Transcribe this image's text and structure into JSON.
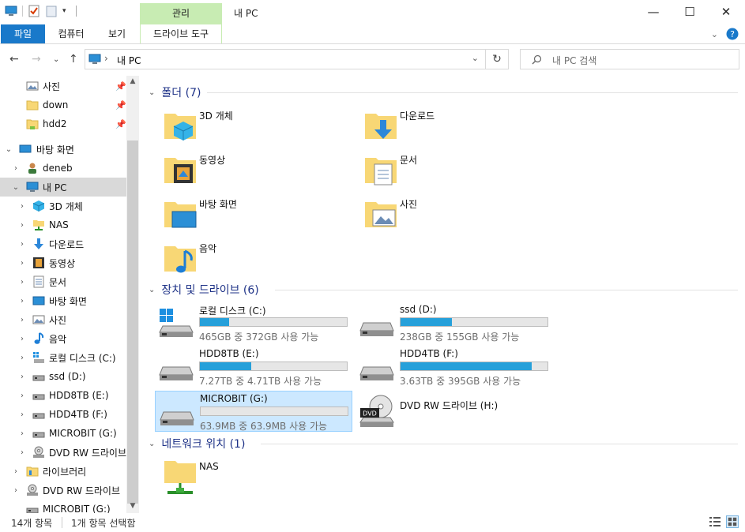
{
  "titlebar": {
    "context_tab_group": "관리",
    "window_title": "내 PC",
    "minimize": "—",
    "maximize": "☐",
    "close": "✕"
  },
  "ribbon": {
    "tabs": [
      "파일",
      "컴퓨터",
      "보기",
      "드라이브 도구"
    ]
  },
  "address": {
    "path_sep": "›",
    "path": "내 PC",
    "refresh": "↻",
    "search_placeholder": "내 PC 검색"
  },
  "nav": {
    "quick_access": [
      {
        "label": "사진",
        "icon": "pictures-icon",
        "pinned": true
      },
      {
        "label": "down",
        "icon": "folder-icon",
        "pinned": true
      },
      {
        "label": "hdd2",
        "icon": "folder-icon",
        "pinned": true
      }
    ],
    "desktop": "바탕 화면",
    "user": "deneb",
    "this_pc": "내 PC",
    "pc_children": [
      {
        "label": "3D 개체",
        "icon": "3d-objects-icon"
      },
      {
        "label": "NAS",
        "icon": "network-drive-icon"
      },
      {
        "label": "다운로드",
        "icon": "download-icon"
      },
      {
        "label": "동영상",
        "icon": "video-icon"
      },
      {
        "label": "문서",
        "icon": "document-icon"
      },
      {
        "label": "바탕 화면",
        "icon": "desktop-icon"
      },
      {
        "label": "사진",
        "icon": "pictures-icon"
      },
      {
        "label": "음악",
        "icon": "music-icon"
      },
      {
        "label": "로컬 디스크 (C:)",
        "icon": "windows-drive-icon"
      },
      {
        "label": "ssd (D:)",
        "icon": "drive-icon"
      },
      {
        "label": "HDD8TB (E:)",
        "icon": "drive-icon"
      },
      {
        "label": "HDD4TB (F:)",
        "icon": "drive-icon"
      },
      {
        "label": "MICROBIT (G:)",
        "icon": "drive-icon"
      },
      {
        "label": "DVD RW 드라이브",
        "icon": "dvd-icon"
      }
    ],
    "libraries": "라이브러리",
    "dvd_root": "DVD RW 드라이브",
    "microbit_root": "MICROBIT (G:)"
  },
  "content": {
    "folders_header": "폴더 (7)",
    "folders": [
      {
        "label": "3D 개체",
        "icon": "3d-objects-icon"
      },
      {
        "label": "다운로드",
        "icon": "download-icon"
      },
      {
        "label": "동영상",
        "icon": "video-icon"
      },
      {
        "label": "문서",
        "icon": "document-icon"
      },
      {
        "label": "바탕 화면",
        "icon": "desktop-icon"
      },
      {
        "label": "사진",
        "icon": "pictures-icon"
      },
      {
        "label": "음악",
        "icon": "music-icon"
      }
    ],
    "devices_header": "장치 및 드라이브 (6)",
    "drives": [
      {
        "label": "로컬 디스크 (C:)",
        "free": "465GB 중 372GB 사용 가능",
        "used_fraction": 0.2
      },
      {
        "label": "ssd (D:)",
        "free": "238GB 중 155GB 사용 가능",
        "used_fraction": 0.35
      },
      {
        "label": "HDD8TB (E:)",
        "free": "7.27TB 중 4.71TB 사용 가능",
        "used_fraction": 0.35
      },
      {
        "label": "HDD4TB (F:)",
        "free": "3.63TB 중 395GB 사용 가능",
        "used_fraction": 0.89
      },
      {
        "label": "MICROBIT (G:)",
        "free": "63.9MB 중 63.9MB 사용 가능",
        "used_fraction": 0.0
      },
      {
        "label": "DVD RW 드라이브 (H:)"
      }
    ],
    "dvd_badge": "DVD",
    "network_header": "네트워크 위치 (1)",
    "network": [
      {
        "label": "NAS"
      }
    ]
  },
  "status": {
    "item_count": "14개 항목",
    "selected": "1개 항목 선택함"
  }
}
